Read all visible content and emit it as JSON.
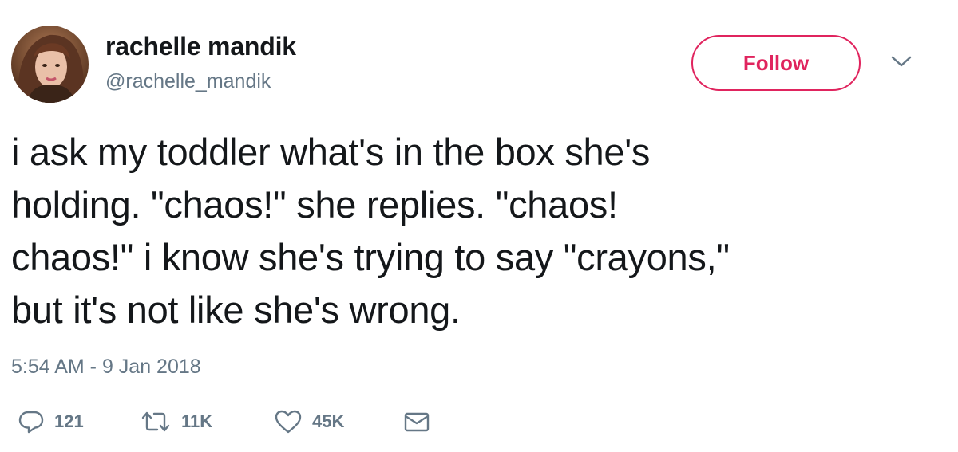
{
  "author": {
    "name": "rachelle mandik",
    "handle": "@rachelle_mandik"
  },
  "follow_button": {
    "label": "Follow"
  },
  "tweet": {
    "lines": [
      "i ask my toddler what's in the box she's",
      "holding. \"chaos!\" she replies. \"chaos!",
      "chaos!\" i know she's trying to say \"crayons,\"",
      "but it's not like she's wrong."
    ],
    "timestamp": "5:54 AM - 9 Jan 2018"
  },
  "actions": {
    "reply_count": "121",
    "retweet_count": "11K",
    "like_count": "45K"
  },
  "icons": {
    "reply": "reply-icon",
    "retweet": "retweet-icon",
    "like": "heart-icon",
    "dm": "envelope-icon",
    "more": "chevron-down-icon"
  },
  "colors": {
    "accent": "#e0245e",
    "text": "#14171a",
    "secondary": "#657786"
  }
}
